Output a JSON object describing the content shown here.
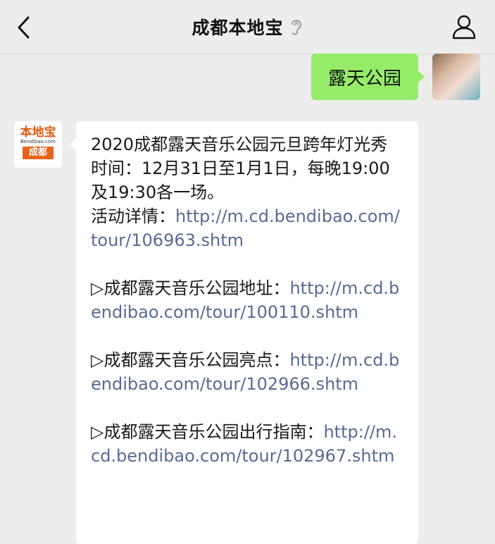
{
  "header": {
    "title": "成都本地宝"
  },
  "colors": {
    "bubble_self": "#95ec69",
    "link": "#576b95",
    "background": "#ededed",
    "brand": "#e8641a"
  },
  "icons": {
    "back": "chevron-left-icon",
    "ear": "ear-icon",
    "profile": "person-icon"
  },
  "chat": {
    "user_message": "露天公园",
    "bot_avatar": {
      "main": "本地宝",
      "sub": "Bendibao.com",
      "city": "成都"
    },
    "reply": {
      "title": "2020成都露天音乐公园元旦跨年灯光秀",
      "time": "时间：12月31日至1月1日，每晚19:00及19:30各一场。",
      "detail_label": "活动详情：",
      "detail_url": "http://m.cd.bendibao.com/tour/106963.shtm",
      "items": [
        {
          "label": "▷成都露天音乐公园地址：",
          "url": "http://m.cd.bendibao.com/tour/100110.shtm"
        },
        {
          "label": "▷成都露天音乐公园亮点：",
          "url": "http://m.cd.bendibao.com/tour/102966.shtm"
        },
        {
          "label": "▷成都露天音乐公园出行指南：",
          "url": "http://m.cd.bendibao.com/tour/102967.shtm"
        }
      ]
    }
  }
}
